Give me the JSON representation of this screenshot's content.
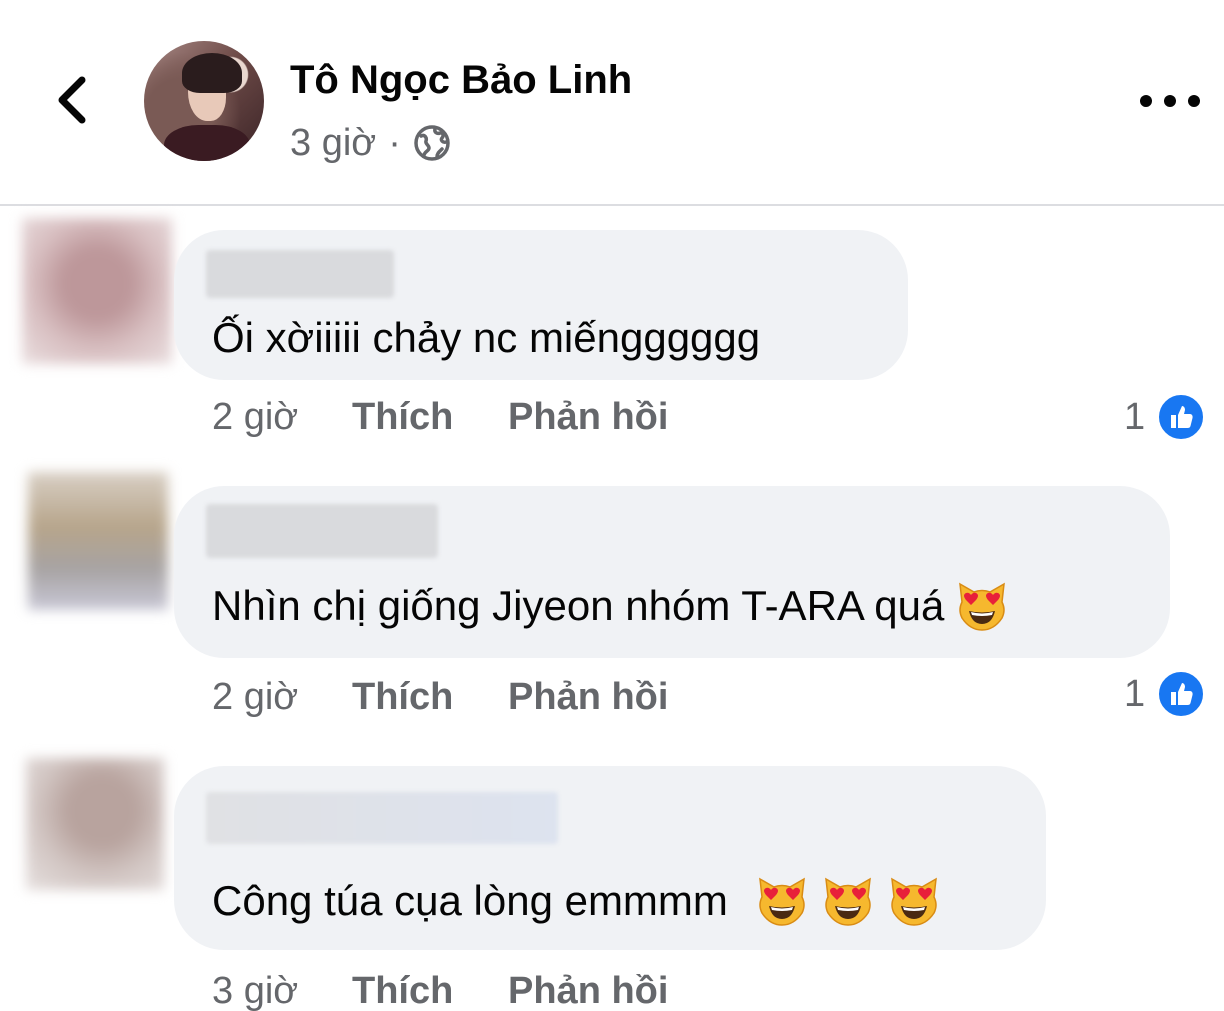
{
  "post": {
    "author": "Tô Ngọc Bảo Linh",
    "time": "3 giờ",
    "separator": "·",
    "audience_icon": "globe-icon"
  },
  "header": {
    "back_icon": "chevron-left-icon",
    "more_icon": "more-horizontal-icon"
  },
  "comments": [
    {
      "text": "Ối xờiiiii chảy nc miếngggggg",
      "emojis": 0,
      "time": "2 giờ",
      "like_label": "Thích",
      "reply_label": "Phản hồi",
      "like_count": "1"
    },
    {
      "text": "Nhìn chị giống Jiyeon nhóm T-ARA quá",
      "emojis": 1,
      "time": "2 giờ",
      "like_label": "Thích",
      "reply_label": "Phản hồi",
      "like_count": "1"
    },
    {
      "text": "Công túa cụa lòng emmmm",
      "emojis": 3,
      "time": "3 giờ",
      "like_label": "Thích",
      "reply_label": "Phản hồi",
      "like_count": ""
    }
  ],
  "colors": {
    "bubble": "#f0f2f5",
    "secondary_text": "#65676b",
    "like_blue": "#1877f2"
  }
}
